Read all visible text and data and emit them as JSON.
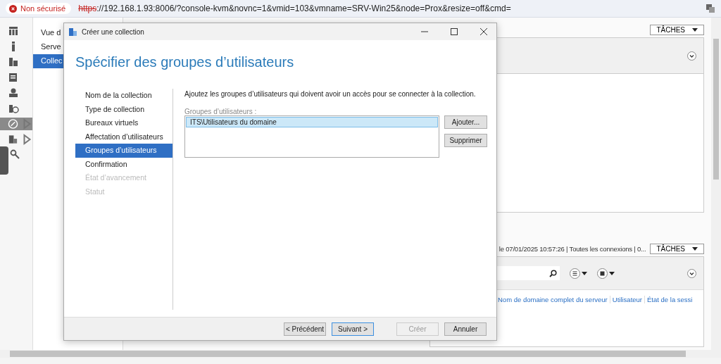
{
  "browser": {
    "security_label": "Non sécurisé",
    "url_scheme": "https",
    "url_rest": "://192.168.1.93:8006/?console-kvm&novnc=1&vmid=103&vmname=SRV-Win25&node=Prox&resize=off&cmd="
  },
  "sidebar": {
    "icons": [
      {
        "selected": false,
        "expandable": false
      },
      {
        "selected": false,
        "expandable": false
      },
      {
        "selected": false,
        "expandable": false
      },
      {
        "selected": false,
        "expandable": false
      },
      {
        "selected": false,
        "expandable": false
      },
      {
        "selected": false,
        "expandable": false
      },
      {
        "selected": true,
        "expandable": true
      },
      {
        "selected": false,
        "expandable": true
      },
      {
        "selected": false,
        "expandable": false
      }
    ]
  },
  "nav": {
    "items": [
      {
        "label": "Vue d",
        "selected": false
      },
      {
        "label": "Serve",
        "selected": false
      },
      {
        "label": "Collec",
        "selected": true
      }
    ]
  },
  "top_panel": {
    "tasks_label": "TÂCHES"
  },
  "connections": {
    "info": "le 07/01/2025 10:57:26 | Toutes les connexions | 0...",
    "tasks_label": "TÂCHES",
    "columns": [
      "Nom de domaine complet du serveur",
      "Utilisateur",
      "État de la sessi"
    ]
  },
  "dialog": {
    "title": "Créer une collection",
    "heading": "Spécifier des groupes d’utilisateurs",
    "steps": [
      {
        "label": "Nom de la collection",
        "selected": false,
        "disabled": false
      },
      {
        "label": "Type de collection",
        "selected": false,
        "disabled": false
      },
      {
        "label": "Bureaux virtuels",
        "selected": false,
        "disabled": false
      },
      {
        "label": "Affectation d’utilisateurs",
        "selected": false,
        "disabled": false
      },
      {
        "label": "Groupes d’utilisateurs",
        "selected": true,
        "disabled": false
      },
      {
        "label": "Confirmation",
        "selected": false,
        "disabled": false
      },
      {
        "label": "État d’avancement",
        "selected": false,
        "disabled": true
      },
      {
        "label": "Statut",
        "selected": false,
        "disabled": true
      }
    ],
    "description": "Ajoutez les groupes d’utilisateurs qui doivent avoir un accès pour se connecter à la collection.",
    "list_label": "Groupes d’utilisateurs :",
    "groups": [
      {
        "name": "ITS\\Utilisateurs du domaine",
        "selected": true
      }
    ],
    "side_buttons": [
      "Ajouter...",
      "Supprimer"
    ],
    "footer_buttons": [
      {
        "label": "< Précédent",
        "default": false,
        "disabled": false
      },
      {
        "label": "Suivant >",
        "default": true,
        "disabled": false
      },
      {
        "label": "Créer",
        "default": false,
        "disabled": true
      },
      {
        "label": "Annuler",
        "default": false,
        "disabled": false
      }
    ]
  }
}
